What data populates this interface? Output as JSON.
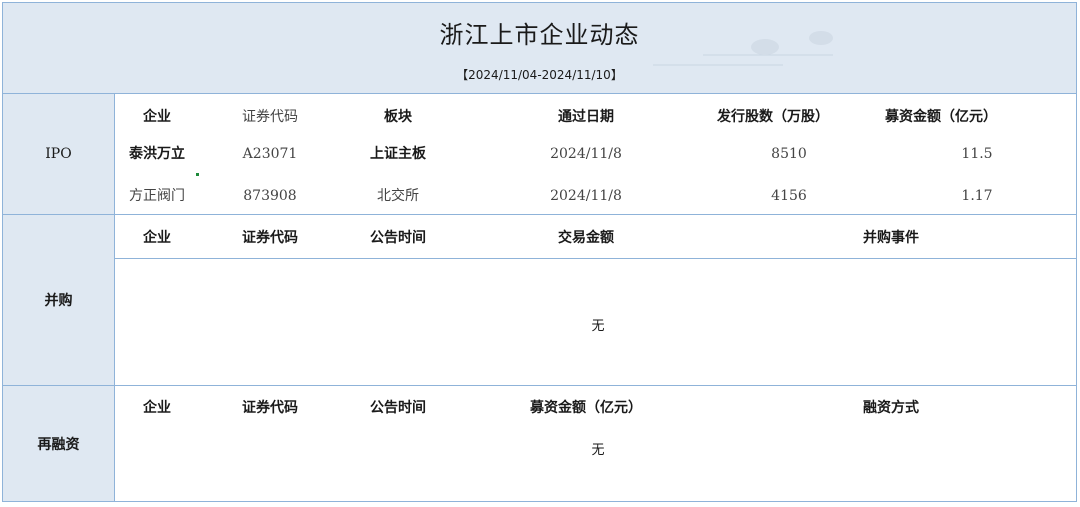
{
  "header": {
    "title": "浙江上市企业动态",
    "date_range": "【2024/11/04-2024/11/10】"
  },
  "ipo": {
    "label": "IPO",
    "headers": [
      "企业",
      "证券代码",
      "板块",
      "通过日期",
      "发行股数（万股）",
      "募资金额（亿元）"
    ],
    "rows": [
      [
        "泰洪万立",
        "A23071",
        "上证主板",
        "2024/11/8",
        "8510",
        "11.5"
      ],
      [
        "方正阀门",
        "873908",
        "北交所",
        "2024/11/8",
        "4156",
        "1.17"
      ]
    ]
  },
  "ma": {
    "label": "并购",
    "headers": [
      "企业",
      "证券代码",
      "公告时间",
      "交易金额",
      "并购事件"
    ],
    "empty_text": "无"
  },
  "refinancing": {
    "label": "再融资",
    "headers": [
      "企业",
      "证券代码",
      "公告时间",
      "募资金额（亿元）",
      "融资方式"
    ],
    "empty_text": "无"
  },
  "colors": {
    "header_bg": "#dfe8f2",
    "border": "#8fb3d9"
  }
}
